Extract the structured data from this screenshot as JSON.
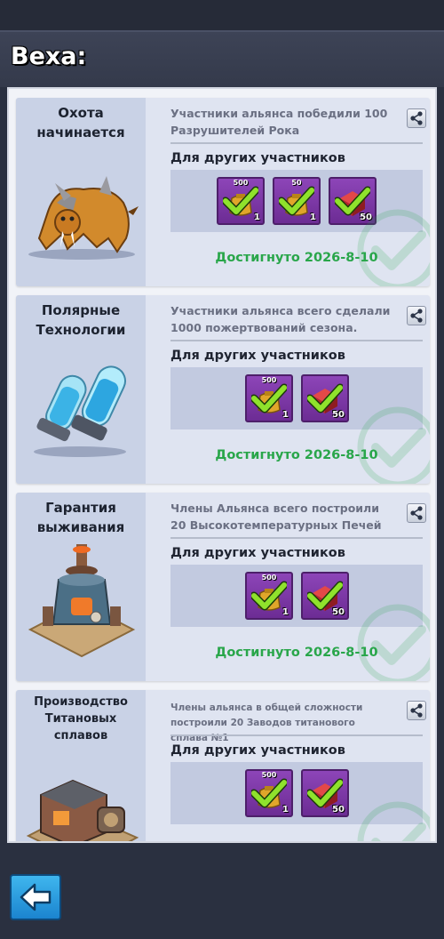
{
  "header": {
    "title": "Веха:"
  },
  "milestones": [
    {
      "title_lines": [
        "Охота",
        "начинается"
      ],
      "image": "sabertooth-beast",
      "description": "Участники альянса победили 100 Разрушителей Рока",
      "subtitle": "Для других участников",
      "rewards": [
        {
          "icon": "gold-bag",
          "top_label": "500",
          "count": "1",
          "claimed": true
        },
        {
          "icon": "gold-bag",
          "top_label": "50",
          "count": "1",
          "claimed": true
        },
        {
          "icon": "red-crate",
          "top_label": "",
          "count": "50",
          "claimed": true
        }
      ],
      "achieved": "Достигнуто 2026-8-10"
    },
    {
      "title_lines": [
        "Полярные",
        "Технологии"
      ],
      "image": "glass-capsules",
      "description": "Участники альянса всего сделали 1000 пожертвований сезона.",
      "subtitle": "Для других участников",
      "rewards": [
        {
          "icon": "gold-bag",
          "top_label": "500",
          "count": "1",
          "claimed": true
        },
        {
          "icon": "red-crate",
          "top_label": "",
          "count": "50",
          "claimed": true
        }
      ],
      "achieved": "Достигнуто 2026-8-10"
    },
    {
      "title_lines": [
        "Гарантия",
        "выживания"
      ],
      "image": "high-temperature-furnace",
      "description": "Члены Альянса всего построили 20 Высокотемпературных Печей",
      "subtitle": "Для других участников",
      "rewards": [
        {
          "icon": "gold-bag",
          "top_label": "500",
          "count": "1",
          "claimed": true
        },
        {
          "icon": "red-crate",
          "top_label": "",
          "count": "50",
          "claimed": true
        }
      ],
      "achieved": "Достигнуто 2026-8-10"
    },
    {
      "title_lines": [
        "Производство",
        "Титановых",
        "сплавов"
      ],
      "image": "titanium-alloy-factory",
      "description": "Члены альянса в общей сложности построили 20 Заводов титанового сплава №1",
      "subtitle": "Для других участников",
      "rewards": [
        {
          "icon": "gold-bag",
          "top_label": "500",
          "count": "1",
          "claimed": true
        },
        {
          "icon": "red-crate",
          "top_label": "",
          "count": "50",
          "claimed": true
        }
      ],
      "achieved": ""
    }
  ],
  "icons": {
    "share": "share-icon",
    "back": "back-arrow-icon",
    "claimed": "check-icon"
  },
  "colors": {
    "achieved": "#29a64a",
    "reward_bg": "#7b36a6",
    "check": "#8fe22c",
    "back_button": "#2a9ee0"
  }
}
